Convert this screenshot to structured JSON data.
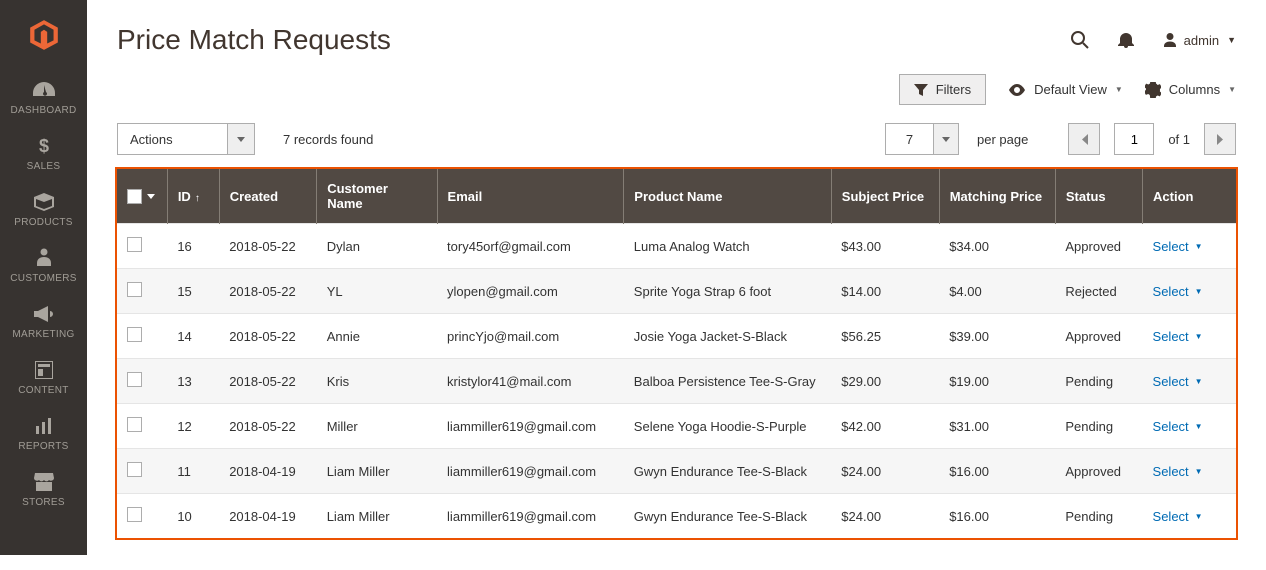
{
  "sidebar": {
    "items": [
      {
        "label": "DASHBOARD",
        "icon": "dashboard-icon",
        "name": "sidebar-item-dashboard"
      },
      {
        "label": "SALES",
        "icon": "dollar-icon",
        "name": "sidebar-item-sales"
      },
      {
        "label": "PRODUCTS",
        "icon": "box-icon",
        "name": "sidebar-item-products"
      },
      {
        "label": "CUSTOMERS",
        "icon": "person-icon",
        "name": "sidebar-item-customers"
      },
      {
        "label": "MARKETING",
        "icon": "megaphone-icon",
        "name": "sidebar-item-marketing"
      },
      {
        "label": "CONTENT",
        "icon": "layout-icon",
        "name": "sidebar-item-content"
      },
      {
        "label": "REPORTS",
        "icon": "reports-icon",
        "name": "sidebar-item-reports"
      },
      {
        "label": "STORES",
        "icon": "stores-icon",
        "name": "sidebar-item-stores"
      }
    ]
  },
  "header": {
    "title": "Price Match Requests",
    "admin_label": "admin"
  },
  "toolbar": {
    "filters_label": "Filters",
    "default_view_label": "Default View",
    "columns_label": "Columns"
  },
  "controls": {
    "actions_label": "Actions",
    "records_found": "7 records found",
    "per_page_value": "7",
    "per_page_label": "per page",
    "page_value": "1",
    "of_label": "of 1"
  },
  "table": {
    "headers": {
      "id": "ID",
      "created": "Created",
      "customer_name": "Customer Name",
      "email": "Email",
      "product_name": "Product Name",
      "subject_price": "Subject Price",
      "matching_price": "Matching Price",
      "status": "Status",
      "action": "Action"
    },
    "action_label": "Select",
    "rows": [
      {
        "id": "16",
        "created": "2018-05-22",
        "customer_name": "Dylan",
        "email": "tory45orf@gmail.com",
        "product_name": "Luma Analog Watch",
        "subject_price": "$43.00",
        "matching_price": "$34.00",
        "status": "Approved"
      },
      {
        "id": "15",
        "created": "2018-05-22",
        "customer_name": "YL",
        "email": "ylopen@gmail.com",
        "product_name": "Sprite Yoga Strap 6 foot",
        "subject_price": "$14.00",
        "matching_price": "$4.00",
        "status": "Rejected"
      },
      {
        "id": "14",
        "created": "2018-05-22",
        "customer_name": "Annie",
        "email": "princYjo@mail.com",
        "product_name": "Josie Yoga Jacket-S-Black",
        "subject_price": "$56.25",
        "matching_price": "$39.00",
        "status": "Approved"
      },
      {
        "id": "13",
        "created": "2018-05-22",
        "customer_name": "Kris",
        "email": "kristylor41@mail.com",
        "product_name": "Balboa Persistence Tee-S-Gray",
        "subject_price": "$29.00",
        "matching_price": "$19.00",
        "status": "Pending"
      },
      {
        "id": "12",
        "created": "2018-05-22",
        "customer_name": "Miller",
        "email": "liammiller619@gmail.com",
        "product_name": "Selene Yoga Hoodie-S-Purple",
        "subject_price": "$42.00",
        "matching_price": "$31.00",
        "status": "Pending"
      },
      {
        "id": "11",
        "created": "2018-04-19",
        "customer_name": "Liam Miller",
        "email": "liammiller619@gmail.com",
        "product_name": "Gwyn Endurance Tee-S-Black",
        "subject_price": "$24.00",
        "matching_price": "$16.00",
        "status": "Approved"
      },
      {
        "id": "10",
        "created": "2018-04-19",
        "customer_name": "Liam Miller",
        "email": "liammiller619@gmail.com",
        "product_name": "Gwyn Endurance Tee-S-Black",
        "subject_price": "$24.00",
        "matching_price": "$16.00",
        "status": "Pending"
      }
    ]
  }
}
